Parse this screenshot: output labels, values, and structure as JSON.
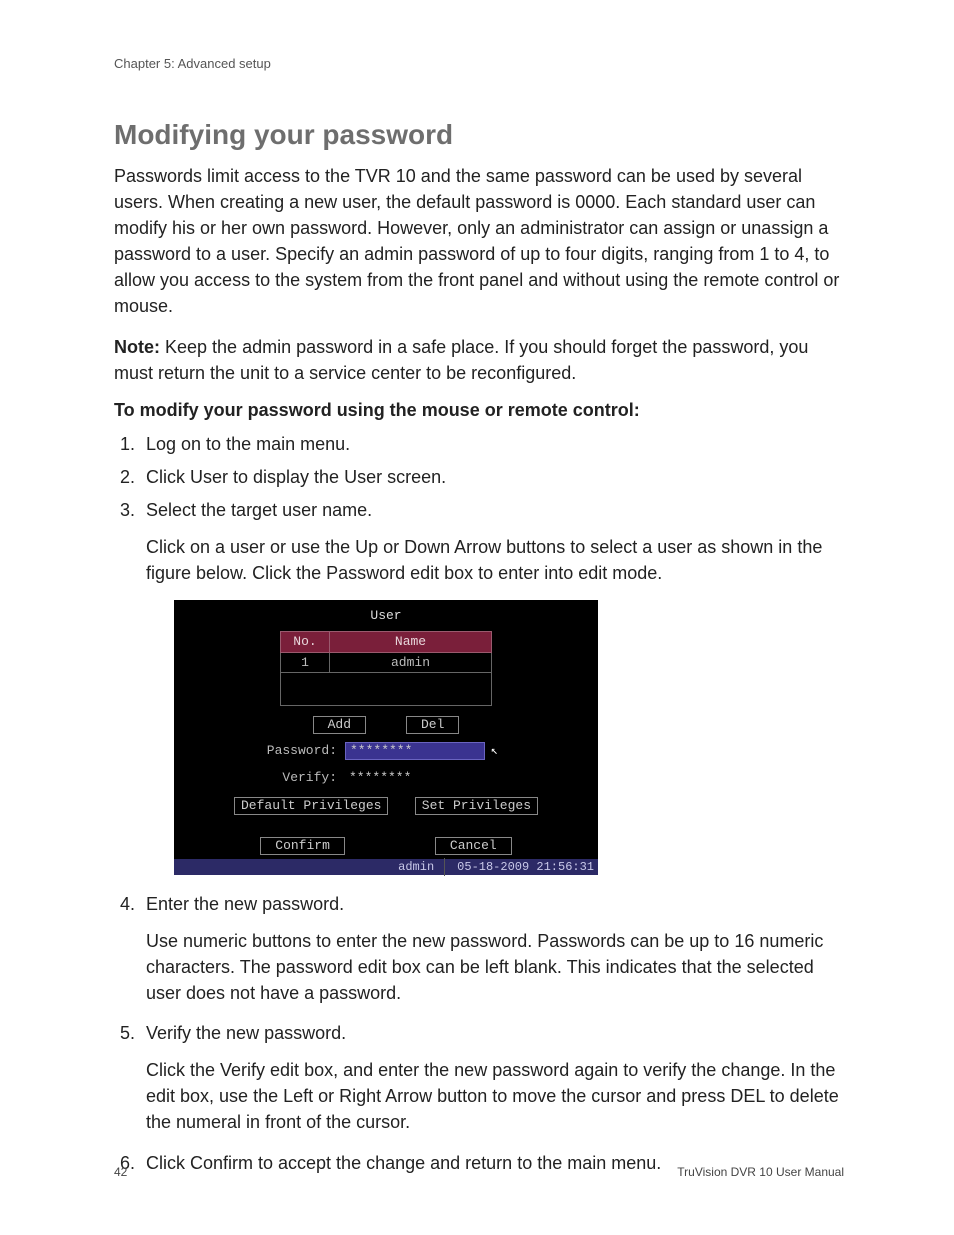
{
  "header": {
    "chapter": "Chapter 5: Advanced setup"
  },
  "title": "Modifying your password",
  "intro": "Passwords limit access to the TVR 10 and the same password can be used by several users. When creating a new user, the default password is 0000. Each standard user can modify his or her own password. However, only an administrator can assign or unassign a password to a user. Specify an admin password of up to four digits, ranging from 1 to 4, to allow you access to the system from the front panel and without using the remote control or mouse.",
  "note_label": "Note:",
  "note_body": " Keep the admin password in a safe place. If you should forget the password, you must return the unit to a service center to be reconfigured.",
  "procedure_heading": "To modify your password using the mouse or remote control:",
  "steps": {
    "s1": "Log on to the main menu.",
    "s2": "Click User to display the User screen.",
    "s3": "Select the target user name.",
    "s3_detail": "Click on a user or use the Up or Down Arrow buttons to select a user as shown in the figure below. Click the Password edit box to enter into edit mode.",
    "s4": "Enter the new password.",
    "s4_detail": "Use numeric buttons to enter the new password. Passwords can be up to 16 numeric characters. The password edit box can be left blank. This indicates that the selected user does not have a password.",
    "s5": "Verify the new password.",
    "s5_detail": "Click the Verify edit box, and enter the new password again to verify the change. In the edit box, use the Left or Right Arrow button to move the cursor and press DEL to delete the numeral in front of the cursor.",
    "s6": "Click Confirm to accept the change and return to the main menu."
  },
  "dvr": {
    "title": "User",
    "col_no": "No.",
    "col_name": "Name",
    "row_no": "1",
    "row_name": "admin",
    "btn_add": "Add",
    "btn_del": "Del",
    "lbl_password": "Password:",
    "val_password": "********",
    "lbl_verify": "Verify:",
    "val_verify": "********",
    "btn_default_priv": "Default Privileges",
    "btn_set_priv": "Set Privileges",
    "btn_confirm": "Confirm",
    "btn_cancel": "Cancel",
    "status_user": "admin",
    "status_datetime": "05-18-2009 21:56:31"
  },
  "footer": {
    "page_no": "42",
    "manual": "TruVision DVR 10 User Manual"
  }
}
